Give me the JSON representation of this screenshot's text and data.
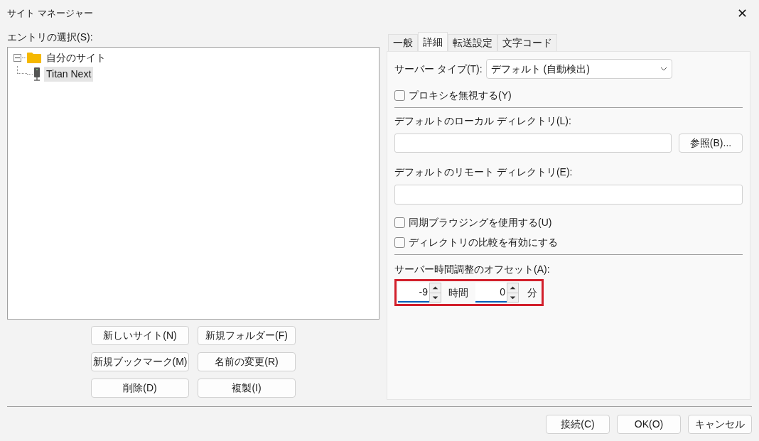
{
  "window": {
    "title": "サイト マネージャー",
    "close": "✕"
  },
  "entries": {
    "label": "エントリの選択(S):",
    "tree": [
      {
        "kind": "folder",
        "label": "自分のサイト",
        "expanded": true,
        "selected": false,
        "children": [
          {
            "kind": "site",
            "label": "Titan Next",
            "selected": true
          }
        ]
      }
    ]
  },
  "entry_buttons": [
    "新しいサイト(N)",
    "新規フォルダー(F)",
    "新規ブックマーク(M)",
    "名前の変更(R)",
    "削除(D)",
    "複製(I)"
  ],
  "tabs": [
    {
      "label": "一般",
      "selected": false
    },
    {
      "label": "詳細",
      "selected": true
    },
    {
      "label": "転送設定",
      "selected": false
    },
    {
      "label": "文字コード",
      "selected": false
    }
  ],
  "details": {
    "server_type": {
      "label": "サーバー タイプ(T):",
      "value": "デフォルト (自動検出)"
    },
    "bypass_proxy": {
      "label": "プロキシを無視する(Y)",
      "checked": false
    },
    "local_dir": {
      "label": "デフォルトのローカル ディレクトリ(L):",
      "browse": "参照(B)..."
    },
    "remote_dir": {
      "label": "デフォルトのリモート ディレクトリ(E):"
    },
    "options": [
      {
        "label": "同期ブラウジングを使用する(U)",
        "checked": false
      },
      {
        "label": "ディレクトリの比較を有効にする",
        "checked": false
      }
    ],
    "offset": {
      "label": "サーバー時間調整のオフセット(A):",
      "highlighted": true,
      "hours": "-9",
      "hours_unit": "時間",
      "minutes": "0",
      "minutes_unit": "分"
    }
  },
  "footer_buttons": [
    "接続(C)",
    "OK(O)",
    "キャンセル"
  ]
}
